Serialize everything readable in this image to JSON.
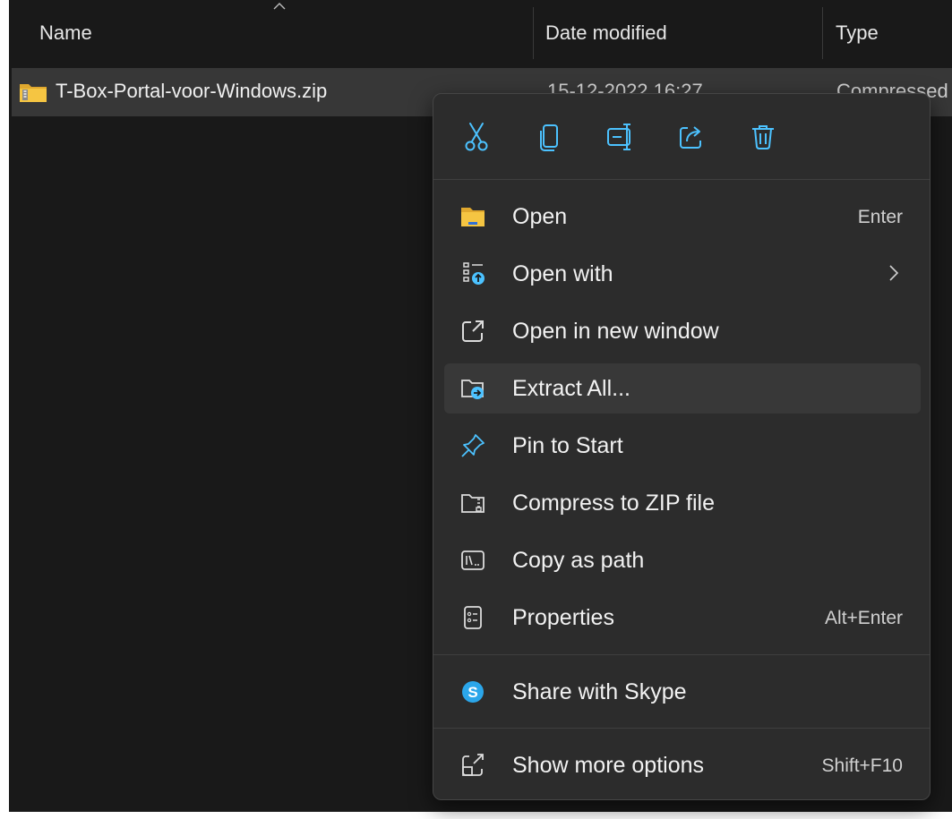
{
  "columns": {
    "name": "Name",
    "date_modified": "Date modified",
    "type": "Type"
  },
  "file": {
    "name": "T-Box-Portal-voor-Windows.zip",
    "date": "15-12-2022 16:27",
    "type": "Compressed"
  },
  "quick_actions": [
    "cut-icon",
    "copy-icon",
    "rename-icon",
    "share-icon",
    "delete-icon"
  ],
  "menu": {
    "open": {
      "label": "Open",
      "shortcut": "Enter"
    },
    "open_with": {
      "label": "Open with"
    },
    "open_new_window": {
      "label": "Open in new window"
    },
    "extract_all": {
      "label": "Extract All..."
    },
    "pin_to_start": {
      "label": "Pin to Start"
    },
    "compress_zip": {
      "label": "Compress to ZIP file"
    },
    "copy_as_path": {
      "label": "Copy as path"
    },
    "properties": {
      "label": "Properties",
      "shortcut": "Alt+Enter"
    },
    "share_skype": {
      "label": "Share with Skype"
    },
    "show_more": {
      "label": "Show more options",
      "shortcut": "Shift+F10"
    }
  },
  "colors": {
    "accent": "#4cc2ff",
    "folder": "#f5c542",
    "skype": "#2ba6ea"
  }
}
